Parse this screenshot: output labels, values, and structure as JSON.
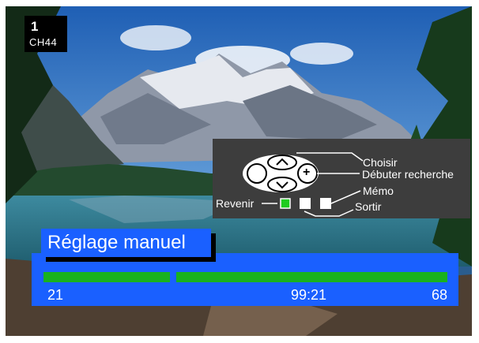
{
  "channel": {
    "number": "1",
    "name": "CH44"
  },
  "help": {
    "choose": "Choisir",
    "start_search": "Débuter recherche",
    "memo": "Mémo",
    "back": "Revenir",
    "exit": "Sortir",
    "minus_symbol": "−",
    "plus_symbol": "+",
    "back_key_color": "#1ecc1e",
    "panel_color": "#3d3d3d"
  },
  "menu": {
    "title": "Réglage manuel",
    "range_start": "21",
    "frequency": "99:21",
    "range_end": "68",
    "panel_color": "#1a60ff",
    "bar_color": "#19b21e"
  }
}
